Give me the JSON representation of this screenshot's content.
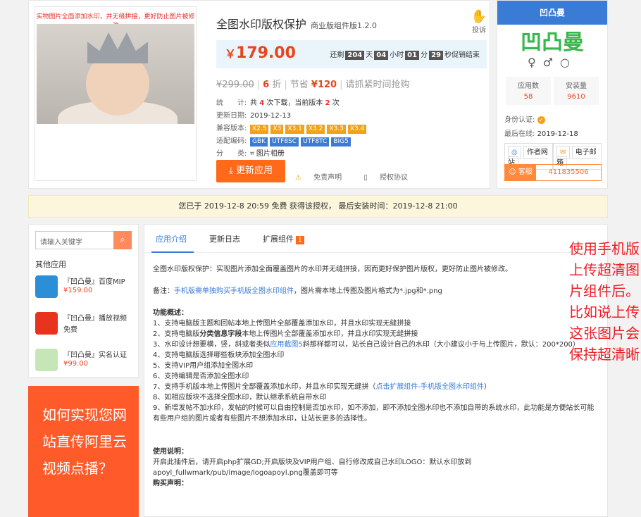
{
  "product": {
    "thumb_caption": "实物图片全面添加水印，并无缝拼接，更好防止图片被修改",
    "title": "全图水印版权保护",
    "version": "商业版组件版1.2.0",
    "report_label": "投诉",
    "price_symbol": "￥",
    "price": "179.00",
    "countdown": {
      "prefix": "还剩",
      "days": "204",
      "days_unit": "天",
      "hours": "04",
      "hours_unit": "小时",
      "minutes": "01",
      "minutes_unit": "分",
      "seconds": "29",
      "seconds_unit": "秒促销结束"
    },
    "original_price": "¥299.00",
    "discount_value": "6",
    "discount_unit": "折",
    "save_label": "节省",
    "save_value": "¥120",
    "promo_text": "请抓紧时间抢购",
    "stats_label": "统　　计:",
    "stats_prefix": "共",
    "downloads": "4",
    "stats_mid": "次下载，当前版本",
    "version_downloads": "2",
    "stats_suffix": "次",
    "updated_label": "更新日期:",
    "updated": "2019-12-13",
    "compat_label": "兼容版本:",
    "compat": [
      "X2.5",
      "X3",
      "X3.1",
      "X3.2",
      "X3.3",
      "X3.4"
    ],
    "encoding_label": "适配编码:",
    "encodings": [
      "GBK",
      "UTF8SC",
      "UTF8TC",
      "BIG5"
    ],
    "category_label": "分　　类:",
    "category": "图片相册",
    "update_button": "更新应用",
    "disclaimer": "免责声明",
    "license": "授权协议"
  },
  "developer": {
    "name": "凹凸曼",
    "logo_text": "凹凸曼",
    "logo_symbols": "♀♂○",
    "apps_label": "应用数",
    "apps": "58",
    "installs_label": "安装量",
    "installs": "9610",
    "auth_label": "身份认证:",
    "last_online_label": "最后在线:",
    "last_online": "2019-12-18",
    "website": "作者网站",
    "email": "电子邮箱",
    "qq_label": "客服",
    "qq": "411835506"
  },
  "notice": "您已于 2019-12-8 20:59 免费 获得该授权， 最后安装时间：2019-12-8 21:00",
  "sidebar": {
    "search_placeholder": "请输入关键字",
    "title": "其他应用",
    "apps": [
      {
        "name": "『凹凸曼』百度MIP",
        "price": "¥159.00"
      },
      {
        "name": "『凹凸曼』播放视频",
        "price": "免费"
      },
      {
        "name": "『凹凸曼』实名认证",
        "price": "¥99.00"
      }
    ],
    "ad_text": "如何实现您网站直传阿里云视频点播？"
  },
  "tabs": [
    {
      "label": "应用介绍"
    },
    {
      "label": "更新日志"
    },
    {
      "label": "扩展组件",
      "badge": "1"
    }
  ],
  "content": {
    "intro": "全图水印版权保护：实现图片添加全面覆盖图片的水印并无缝拼接，因而更好保护图片版权，更好防止图片被修改。",
    "note_prefix": "备注：",
    "note_link": "手机版需单独购买手机版全图水印组件",
    "note_suffix": "，图片需本地上传图及图片格式为*.jpg和*.png",
    "features_title": "功能概述：",
    "f1": "1、支持电脑版主题和回帖本地上传图片全部覆盖添加水印，并且水印实现无缝拼接",
    "f2_a": "2、支持电脑版",
    "f2_b": "分类信息字段",
    "f2_c": "本地上传图片全部覆盖添加水印，并且水印实现无缝拼接",
    "f3_a": "3、水印设计想要横，竖，斜或者类似",
    "f3_link": "应用截图5",
    "f3_b": "斜那样都可以，站长自己设计自己的水印（大小建议小于与上传图片，默认：200*200）",
    "f4": "4、支持电脑版选择哪些板块添加全图水印",
    "f5": "5、支持VIP用户组添加全图水印",
    "f6": "6、支持编辑是否添加全图水印",
    "f7_a": "7、支持手机版本地上传图片全部覆盖添加水印，并且水印实现无缝拼（",
    "f7_link": "点击扩展组件-手机版全图水印组件",
    "f7_b": "）",
    "f8": "8、如相应版块不选择全图水印，默认继承系统自带水印",
    "f9": "9、新增发帖不加水印，发帖的时候可以自由控制是否加水印，如不添加，即不添加全图水印也不添加自带的系统水印，此功能是方便站长可能有些用户组的图片或者有些图片不想添加水印，让站长更多的选择性。",
    "usage_title": "使用说明：",
    "usage_1": "开启此插件后，请开启php扩展GD;开启版块及VIP用户组、自行修改成自己水印LOGO：默认水印放到",
    "usage_2": "apoyl_fullwmark/pub/image/logoapoyl.png覆盖即可等",
    "purchase_title": "购买声明："
  },
  "annotation": "使用手机版上传超清图片组件后。比如说上传这张图片会保持超清晰"
}
